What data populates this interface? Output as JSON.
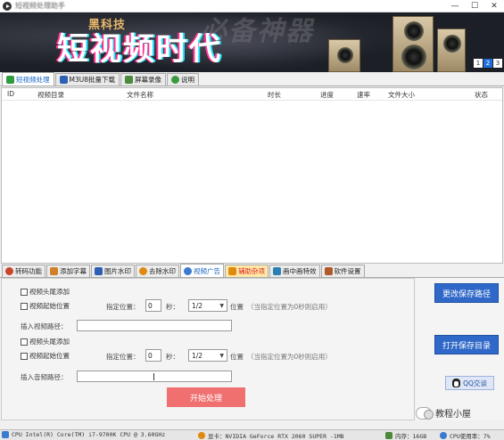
{
  "window": {
    "title": "短视频处理助手",
    "minimize": "—",
    "maximize": "☐",
    "close": "✕"
  },
  "banner": {
    "subtitle": "黑科技",
    "headline": "短视频时代",
    "ghost_text": "必备神器",
    "pager": [
      "1",
      "2",
      "3"
    ],
    "pager_active": "2"
  },
  "top_tabs": [
    {
      "label": "短视频处理",
      "icon": "film-icon",
      "color": "#2e9c3e"
    },
    {
      "label": "M3U8批量下载",
      "icon": "download-icon",
      "color": "#2d5fb3"
    },
    {
      "label": "屏幕录像",
      "icon": "screen-record-icon",
      "color": "#4a8a3a"
    },
    {
      "label": "说明",
      "icon": "help-icon",
      "color": "#3c9a3c"
    }
  ],
  "table": {
    "columns": [
      "ID",
      "视频目录",
      "文件名称",
      "时长",
      "进度",
      "速率",
      "文件大小",
      "状态"
    ],
    "rows": []
  },
  "bottom_tabs": [
    {
      "label": "转码功能",
      "icon": "transcode-icon",
      "color": "#c8462b"
    },
    {
      "label": "添加字幕",
      "icon": "subtitle-icon",
      "color": "#d0802a"
    },
    {
      "label": "图片水印",
      "icon": "image-watermark-icon",
      "color": "#2d5fb3"
    },
    {
      "label": "去除水印",
      "icon": "remove-watermark-icon",
      "color": "#e08a10"
    },
    {
      "label": "视频广告",
      "icon": "video-ad-icon",
      "color": "#3a7ad0"
    },
    {
      "label": "辅助杂项",
      "icon": "misc-icon",
      "color": "#e08a10"
    },
    {
      "label": "画中画特效",
      "icon": "pip-icon",
      "color": "#2d7fb3"
    },
    {
      "label": "软件设置",
      "icon": "settings-icon",
      "color": "#b05a2a"
    }
  ],
  "active_bottom_tab": "视频广告",
  "panel": {
    "head_tail_add": "视频头尾添加",
    "start_pos_1": "视频起始位置",
    "specify_pos_label": "指定位置：",
    "spin_1": "0",
    "seconds_label": "秒：",
    "select_1": "1/2",
    "position_label": "位置",
    "note_1": "（当指定位置为0秒则启用）",
    "insert_video_path": "插入视频路径：",
    "head_tail_add_2": "视频头尾添加",
    "start_pos_2": "视频起始位置",
    "spin_2": "0",
    "select_2": "1/2",
    "note_2": "（当指定位置为0秒则启用）",
    "insert_audio_path": "插入音频路径：",
    "start_button": "开始处理"
  },
  "right": {
    "change_save_path": "更改保存路径",
    "open_save_dir": "打开保存目录",
    "qq_chat": "QQ交谈"
  },
  "watermark": "教程小屋",
  "status": {
    "cpu": "CPU Intel(R) Core(TM) i7-9700K CPU @ 3.60GHz",
    "gpu": "显卡：NVIDIA GeForce RTX 2060 SUPER  -1MB",
    "memory": "内存：16GB",
    "cpu_usage": "CPU使用率：7%"
  },
  "colors": {
    "accent_blue": "#2f68c8",
    "start_button": "#f07070",
    "active_tab_text": "#1565c0"
  }
}
